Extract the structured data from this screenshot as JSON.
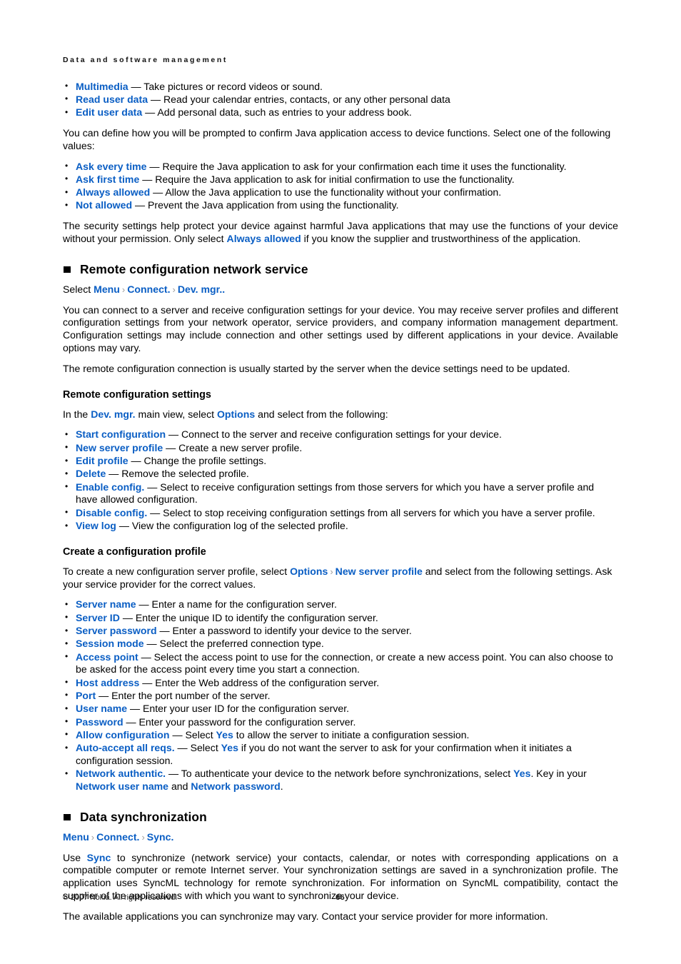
{
  "header": {
    "running_title": "Data and software management"
  },
  "permissions_list": [
    {
      "term": "Multimedia",
      "desc": " — Take pictures or record videos or sound."
    },
    {
      "term": "Read user data",
      "desc": " — Read your calendar entries, contacts, or any other personal data"
    },
    {
      "term": "Edit user data",
      "desc": " — Add personal data, such as entries to your address book."
    }
  ],
  "paragraphs": {
    "java_prompt": "You can define how you will be prompted to confirm Java application access to device functions. Select one of the following values:"
  },
  "prompt_values_list": [
    {
      "term": "Ask every time",
      "desc": " — Require the Java application to ask for your confirmation each time it uses the functionality."
    },
    {
      "term": "Ask first time",
      "desc": " — Require the Java application to ask for initial confirmation to use the functionality."
    },
    {
      "term": "Always allowed",
      "desc": " — Allow the Java application to use the functionality without your confirmation."
    },
    {
      "term": "Not allowed",
      "desc": " — Prevent the Java application from using the functionality."
    }
  ],
  "security_note": {
    "part1": "The security settings help protect your device against harmful Java applications that may use the functions of your device without your permission. Only select ",
    "link": "Always allowed",
    "part2": " if you know the supplier and trustworthiness of the application."
  },
  "remote_config": {
    "heading": "Remote configuration network service",
    "select_label": "Select ",
    "crumbs": [
      "Menu",
      "Connect.",
      "Dev. mgr.."
    ],
    "chevron": "›",
    "body1": "You can connect to a server and receive configuration settings for your device. You may receive server profiles and different configuration settings from your network operator, service providers, and company information management department. Configuration settings may include connection and other settings used by different applications in your device. Available options may vary.",
    "body2": "The remote configuration connection is usually started by the server when the device settings need to be updated."
  },
  "remote_settings": {
    "heading": "Remote configuration settings",
    "intro_pre": "In the ",
    "intro_link1": "Dev. mgr.",
    "intro_mid": " main view, select ",
    "intro_link2": "Options",
    "intro_post": " and select from the following:",
    "items": [
      {
        "term": "Start configuration",
        "desc": " — Connect to the server and receive configuration settings for your device."
      },
      {
        "term": "New server profile",
        "desc": " — Create a new server profile."
      },
      {
        "term": "Edit profile",
        "desc": " — Change the profile settings."
      },
      {
        "term": "Delete",
        "desc": " — Remove the selected profile."
      },
      {
        "term": "Enable config.",
        "desc": " — Select to receive configuration settings from those servers for which you have a server profile and have allowed configuration."
      },
      {
        "term": "Disable config.",
        "desc": " — Select to stop receiving configuration settings from all servers for which you have a server profile."
      },
      {
        "term": "View log",
        "desc": " — View the configuration log of the selected profile."
      }
    ]
  },
  "create_profile": {
    "heading": "Create a configuration profile",
    "intro_pre": "To create a new configuration server profile, select ",
    "intro_link1": "Options",
    "chevron": "›",
    "intro_link2": "New server profile",
    "intro_post": " and select from the following settings. Ask your service provider for the correct values.",
    "items": [
      {
        "term": "Server name",
        "desc": " — Enter a name for the configuration server."
      },
      {
        "term": "Server ID",
        "desc": " — Enter the unique ID to identify the configuration server."
      },
      {
        "term": "Server password",
        "desc": " — Enter a password to identify your device to the server."
      },
      {
        "term": "Session mode",
        "desc": " — Select the preferred connection type."
      },
      {
        "term": "Access point",
        "desc": " — Select the access point to use for the connection, or create a new access point. You can also choose to be asked for the access point every time you start a connection."
      },
      {
        "term": "Host address",
        "desc": " — Enter the Web address of the configuration server."
      },
      {
        "term": "Port",
        "desc": " — Enter the port number of the server."
      },
      {
        "term": "User name",
        "desc": " — Enter your user ID for the configuration server."
      },
      {
        "term": "Password",
        "desc": " — Enter your password for the configuration server."
      }
    ],
    "allow_config": {
      "term": "Allow configuration",
      "pre": " — Select ",
      "yes": "Yes",
      "post": " to allow the server to initiate a configuration session."
    },
    "auto_accept": {
      "term": "Auto-accept all reqs.",
      "pre": " — Select ",
      "yes": "Yes",
      "post": " if you do not want the server to ask for your confirmation when it initiates a configuration session."
    },
    "network_auth": {
      "term": "Network authentic.",
      "pre": " — To authenticate your device to the network before synchronizations, select ",
      "yes": "Yes",
      "mid": ". Key in your ",
      "link1": "Network user name",
      "and": " and ",
      "link2": "Network password",
      "post": "."
    }
  },
  "data_sync": {
    "heading": "Data synchronization",
    "crumbs": [
      "Menu",
      "Connect.",
      "Sync."
    ],
    "chevron": "›",
    "body_pre": "Use ",
    "body_link": "Sync",
    "body_post": " to synchronize (network service) your contacts, calendar, or notes with corresponding applications on a compatible computer or remote Internet server. Your synchronization settings are saved in a synchronization profile. The application uses SyncML technology for remote synchronization. For information on SyncML compatibility, contact the supplier of the applications with which you want to synchronize your device.",
    "body2": "The available applications you can synchronize may vary. Contact your service provider for more information."
  },
  "footer": {
    "copyright": "© 2007 Nokia. All rights reserved.",
    "page_number": "66"
  },
  "colors": {
    "link_blue": "#0a5ec4",
    "chevron_gray": "#9b9b9b",
    "text_black": "#000000",
    "page_background": "#ffffff"
  }
}
